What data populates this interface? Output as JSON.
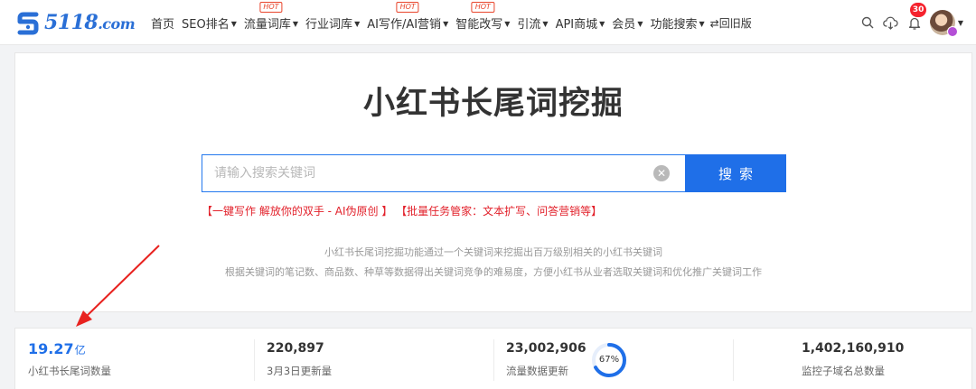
{
  "brand": {
    "logo_text": "5118",
    "logo_suffix": ".com",
    "accent": "#2a6fd6"
  },
  "nav": {
    "items": [
      {
        "label": "首页",
        "caret": false,
        "hot": false
      },
      {
        "label": "SEO排名",
        "caret": true,
        "hot": false
      },
      {
        "label": "流量词库",
        "caret": true,
        "hot": true
      },
      {
        "label": "行业词库",
        "caret": true,
        "hot": false
      },
      {
        "label": "AI写作/AI营销",
        "caret": true,
        "hot": true
      },
      {
        "label": "智能改写",
        "caret": true,
        "hot": true
      },
      {
        "label": "引流",
        "caret": true,
        "hot": false
      },
      {
        "label": "API商城",
        "caret": true,
        "hot": false
      },
      {
        "label": "会员",
        "caret": true,
        "hot": false
      },
      {
        "label": "功能搜索",
        "caret": true,
        "hot": false
      }
    ],
    "hot_label": "HOT",
    "back_label": "⇄回旧版",
    "notification_count": "30"
  },
  "main": {
    "title": "小红书长尾词挖掘",
    "search_placeholder": "请输入搜索关键词",
    "search_button": "搜索",
    "promo_1": "【一键写作 解放你的双手 - AI伪原创 】",
    "promo_2": "【批量任务管家：文本扩写、问答营销等】",
    "desc_line_1": "小红书长尾词挖掘功能通过一个关键词来挖掘出百万级别相关的小红书关键词",
    "desc_line_2": "根据关键词的笔记数、商品数、种草等数据得出关键词竞争的难易度，方便小红书从业者选取关键词和优化推广关键词工作"
  },
  "stats": {
    "total": {
      "value": "19.27",
      "unit": "亿",
      "label": "小红书长尾词数量"
    },
    "updated": {
      "value": "220,897",
      "label": "3月3日更新量"
    },
    "traffic": {
      "value": "23,002,906",
      "label": "流量数据更新",
      "progress_percent": 67,
      "progress_label": "67%"
    },
    "domains": {
      "value": "1,402,160,910",
      "label": "监控子域名总数量"
    }
  },
  "colors": {
    "primary": "#1f6fe8",
    "promo": "#e2202a",
    "badge": "#f5222d"
  }
}
